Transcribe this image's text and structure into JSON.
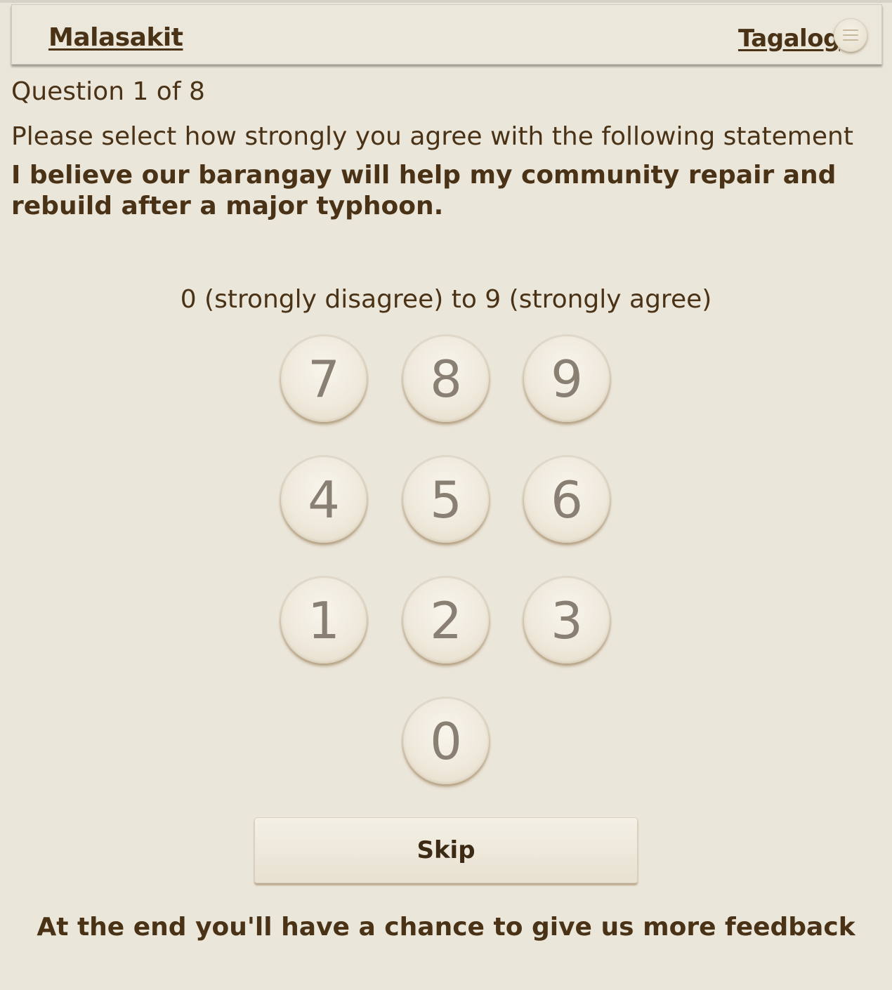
{
  "header": {
    "brand": "Malasakit",
    "language": "Tagalog",
    "menu_icon": "menu-icon"
  },
  "question": {
    "counter": "Question 1 of 8",
    "instruction": "Please select how strongly you agree with the following statement",
    "statement": "I believe our barangay will help my community repair and rebuild after a major typhoon."
  },
  "scale": {
    "label": "0 (strongly disagree) to 9 (strongly agree)"
  },
  "keypad": {
    "k7": "7",
    "k8": "8",
    "k9": "9",
    "k4": "4",
    "k5": "5",
    "k6": "6",
    "k1": "1",
    "k2": "2",
    "k3": "3",
    "k0": "0"
  },
  "skip_label": "Skip",
  "footer": "At the end you'll have a chance to give us more feedback",
  "colors": {
    "background": "#ebe6da",
    "text": "#4a3216",
    "key_digit": "#8a7f73"
  }
}
